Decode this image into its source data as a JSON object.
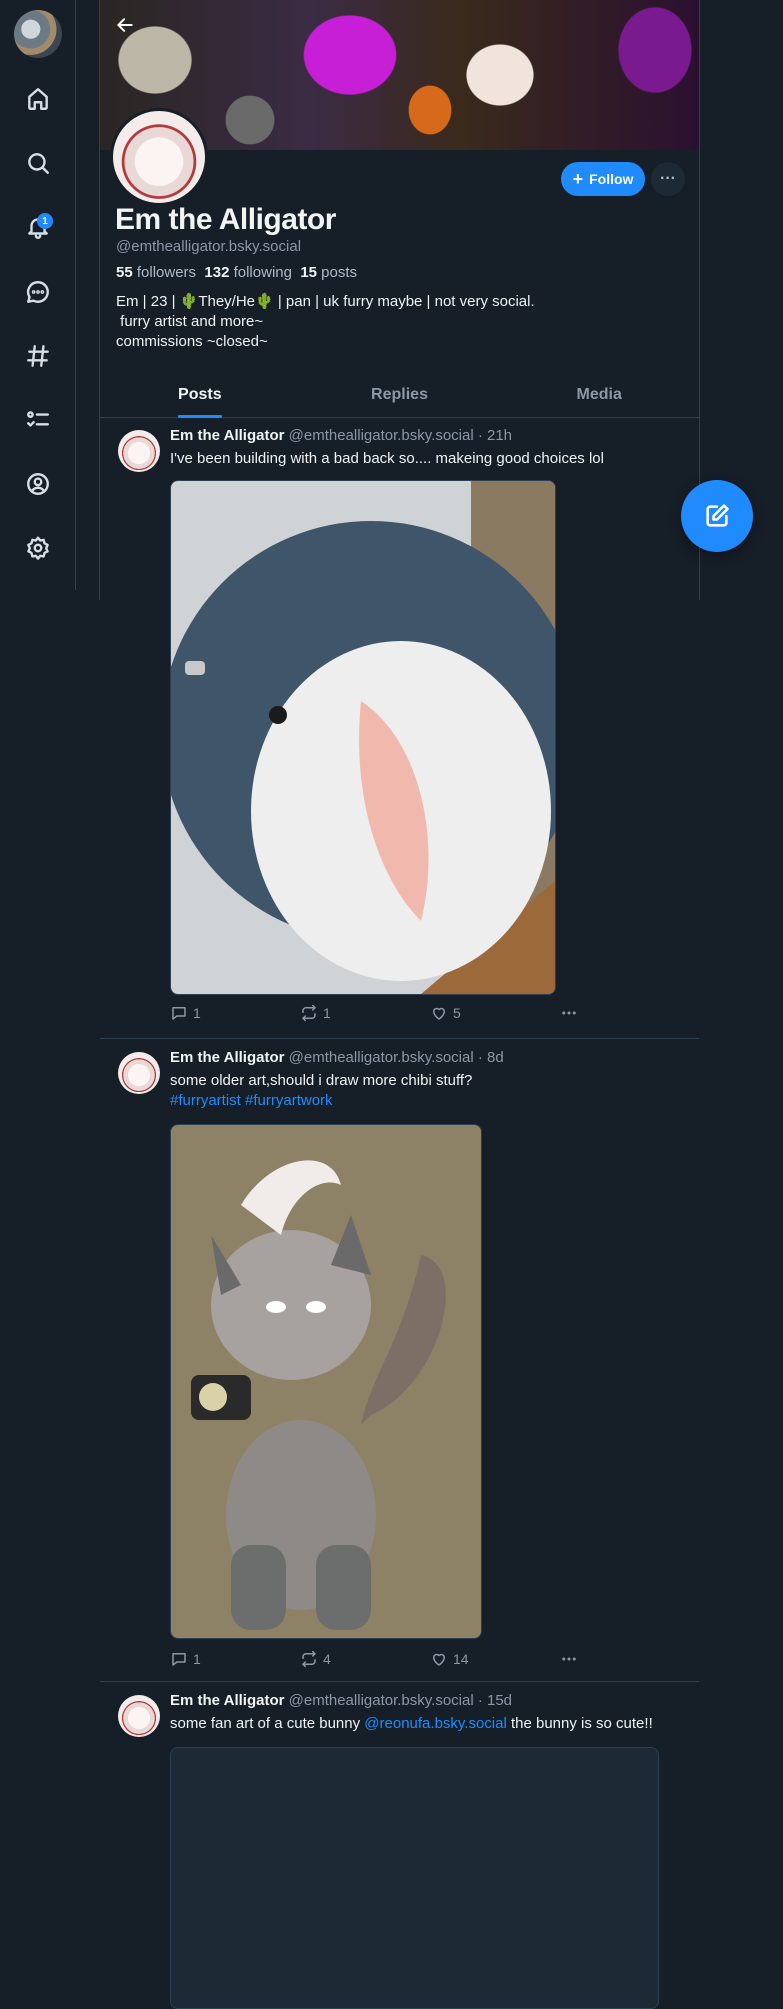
{
  "nav": {
    "notification_count": "1",
    "items": [
      {
        "icon": "home-icon"
      },
      {
        "icon": "search-icon"
      },
      {
        "icon": "bell-icon"
      },
      {
        "icon": "chat-icon"
      },
      {
        "icon": "hashtag-icon"
      },
      {
        "icon": "list-icon"
      },
      {
        "icon": "profile-icon"
      },
      {
        "icon": "gear-icon"
      }
    ]
  },
  "profile": {
    "display_name": "Em the Alligator",
    "handle": "@emthealligator.bsky.social",
    "followers_count": "55",
    "followers_label": "followers",
    "following_count": "132",
    "following_label": "following",
    "posts_count": "15",
    "posts_label": "posts",
    "bio_line1": "Em | 23 | 🌵They/He🌵 | pan | uk furry maybe | not very social.",
    "bio_line2": " furry artist and more~",
    "bio_line3": "commissions ~closed~",
    "follow_label": "Follow",
    "more_label": "···"
  },
  "tabs": [
    "Posts",
    "Replies",
    "Media"
  ],
  "posts": [
    {
      "author": "Em the Alligator",
      "meta": "@emthealligator.bsky.social · 21h",
      "text": "I've been building with a bad back so.... makeing good choices lol",
      "replies": "1",
      "reposts": "1",
      "likes": "5"
    },
    {
      "author": "Em the Alligator",
      "meta": "@emthealligator.bsky.social · 8d",
      "text": "some older art,should i draw more chibi stuff?",
      "tags": "#furryartist #furryartwork",
      "replies": "1",
      "reposts": "4",
      "likes": "14"
    },
    {
      "author": "Em the Alligator",
      "meta": "@emthealligator.bsky.social · 15d",
      "text_before": "some fan art of a cute bunny ",
      "mention": "@reonufa.bsky.social",
      "text_after": " the bunny is so cute!!"
    }
  ],
  "colors": {
    "accent": "#208bfe",
    "background": "#161e27",
    "border": "#2e4052",
    "muted": "#8b98a5"
  }
}
